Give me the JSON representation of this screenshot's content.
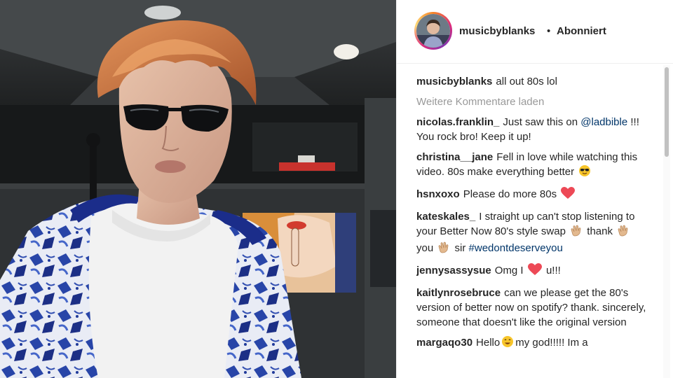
{
  "post": {
    "author": "musicbyblanks",
    "separator": "•",
    "follow_status": "Abonniert",
    "photo_description": "selfie-photo",
    "caption": {
      "user": "musicbyblanks",
      "text": "all out 80s lol"
    },
    "load_more_label": "Weitere Kommentare laden",
    "comments": [
      {
        "user": "nicolas.franklin_",
        "text1": "Just saw this on",
        "mention": "@ladbible",
        "text2": "!!! You rock bro! Keep it up!"
      },
      {
        "user": "christina__jane",
        "text": "Fell in love while watching this video. 80s make everything better",
        "emoji": "sunglasses-emoji"
      },
      {
        "user": "hsnxoxo",
        "text": "Please do more 80s",
        "emoji": "heart-emoji"
      },
      {
        "user": "kateskales_",
        "text1": "I straight up can't stop listening to your Better Now 80's style swap",
        "w1": "thank",
        "w2": "you",
        "w3": "sir",
        "hashtag": "#wedontdeserveyou",
        "emoji": "clap-emoji"
      },
      {
        "user": "jennysassysue",
        "text1": "Omg I",
        "text2": "u!!!",
        "emoji": "heart-emoji"
      },
      {
        "user": "kaitlynrosebruce",
        "text": "can we please get the 80's version of better now on spotify? thank. sincerely, someone that doesn't like the original version"
      },
      {
        "user": "margaqo30",
        "text1": "Hello",
        "text2": "my god!!!!! Im a",
        "emoji": "smile-emoji"
      }
    ]
  },
  "colors": {
    "text": "#262626",
    "muted": "#999999",
    "link": "#003569",
    "heart": "#ed4956",
    "divider": "#efefef"
  }
}
